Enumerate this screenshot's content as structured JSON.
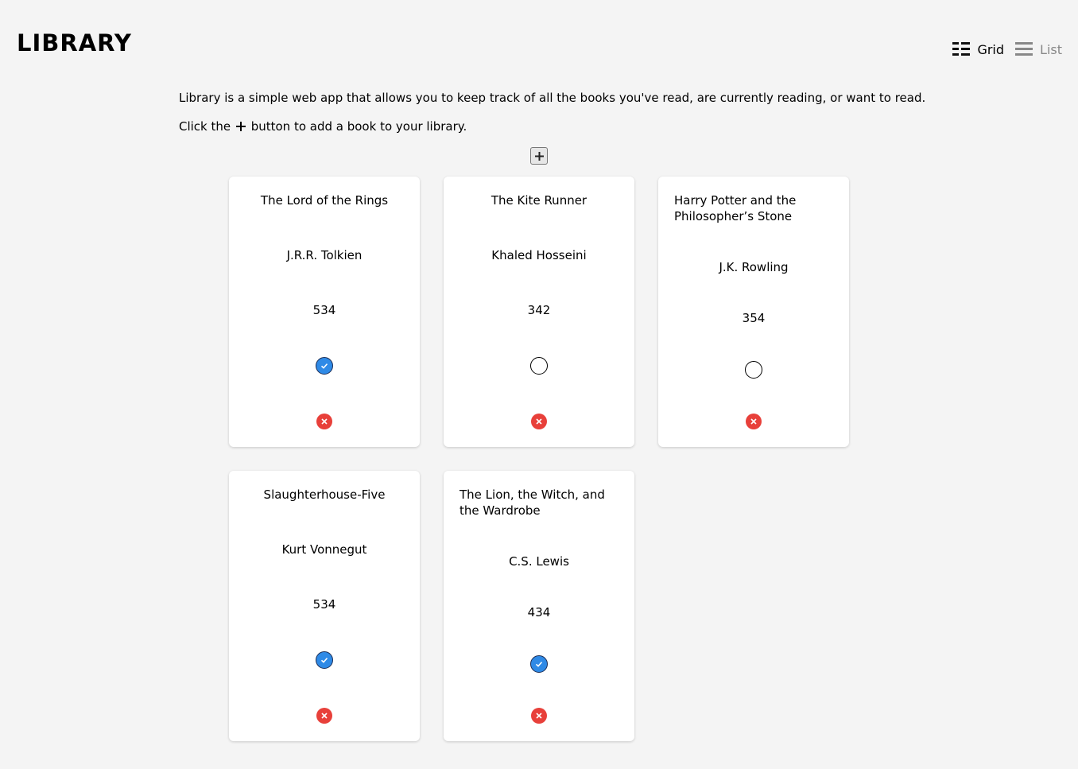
{
  "header": {
    "logo": "LIBRARY",
    "views": {
      "grid_label": "Grid",
      "list_label": "List",
      "active": "grid"
    }
  },
  "intro": {
    "line1": "Library is a simple web app that allows you to keep track of all the books you've read, are currently reading, or want to read.",
    "line2_before": "Click the",
    "line2_after": "button to add a book to your library."
  },
  "add_button": {
    "icon": "plus-icon"
  },
  "books": [
    {
      "title": "The Lord of the Rings",
      "author": "J.R.R. Tolkien",
      "pages": "534",
      "read": true
    },
    {
      "title": "The Kite Runner",
      "author": "Khaled Hosseini",
      "pages": "342",
      "read": false
    },
    {
      "title": "Harry Potter and the Philosopher’s Stone",
      "author": "J.K. Rowling",
      "pages": "354",
      "read": false
    },
    {
      "title": "Slaughterhouse-Five",
      "author": "Kurt Vonnegut",
      "pages": "534",
      "read": true
    },
    {
      "title": "The Lion, the Witch, and the Wardrobe",
      "author": "C.S. Lewis",
      "pages": "434",
      "read": true
    }
  ],
  "colors": {
    "background": "#f4f4f4",
    "card": "#ffffff",
    "read_check": "#2f8ae6",
    "remove": "#e8403a"
  }
}
